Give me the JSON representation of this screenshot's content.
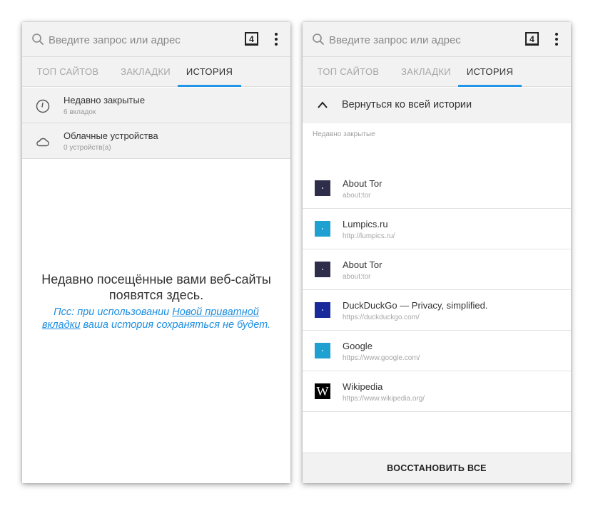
{
  "urlbar": {
    "placeholder": "Введите запрос или адрес",
    "tab_count": "4"
  },
  "tabs": [
    {
      "label": "ТОП САЙТОВ"
    },
    {
      "label": "ЗАКЛАДКИ"
    },
    {
      "label": "ИСТОРИЯ"
    }
  ],
  "left": {
    "rows": [
      {
        "title": "Недавно закрытые",
        "subtitle": "6 вкладок",
        "icon": "clock-icon"
      },
      {
        "title": "Облачные устройства",
        "subtitle": "0 устройств(а)",
        "icon": "cloud-icon"
      }
    ],
    "empty_title": "Недавно посещённые вами веб-сайты появятся здесь.",
    "hint_before": "Псс: при использовании ",
    "hint_link": "Новой приватной вкладки",
    "hint_after": " ваша история сохраняться не будет."
  },
  "right": {
    "back_label": "Вернуться ко всей истории",
    "section_label": "Недавно закрытые",
    "sites": [
      {
        "title": "About Tor",
        "url": "about:tor",
        "color": "#2e2e4a"
      },
      {
        "title": "Lumpics.ru",
        "url": "http://lumpics.ru/",
        "color": "#1ea0d0"
      },
      {
        "title": "About Tor",
        "url": "about:tor",
        "color": "#2e2e4a"
      },
      {
        "title": "DuckDuckGo — Privacy, simplified.",
        "url": "https://duckduckgo.com/",
        "color": "#1a2a9a"
      },
      {
        "title": "Google",
        "url": "https://www.google.com/",
        "color": "#1ea0d0"
      },
      {
        "title": "Wikipedia",
        "url": "https://www.wikipedia.org/",
        "color": "#000000",
        "glyph": "W"
      }
    ],
    "restore_label": "ВОССТАНОВИТЬ ВСЕ"
  },
  "colors": {
    "accent": "#2196e6",
    "link": "#1e8ee0",
    "bar": "#f2f2f2"
  }
}
